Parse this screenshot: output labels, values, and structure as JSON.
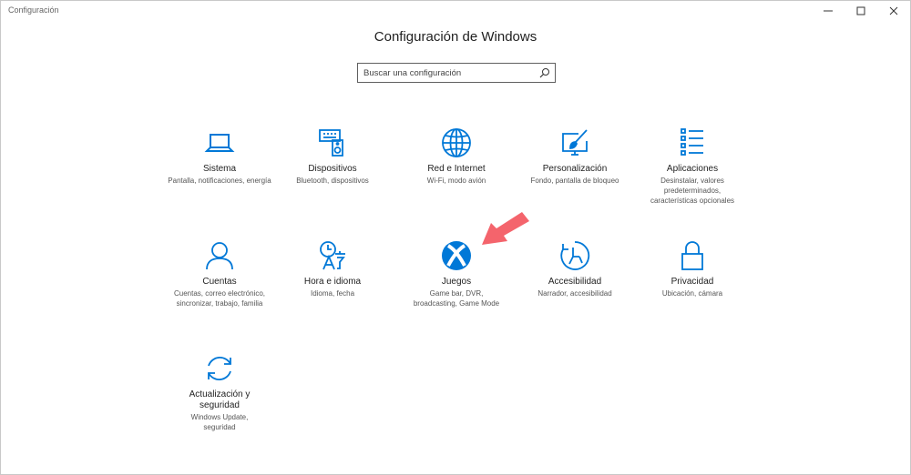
{
  "window": {
    "app_title": "Configuración",
    "controls": [
      "minimize-icon",
      "maximize-icon",
      "close-icon"
    ]
  },
  "header": {
    "title": "Configuración de Windows"
  },
  "search": {
    "placeholder": "Buscar una configuración",
    "icon": "search-icon"
  },
  "colors": {
    "accent": "#0078d7",
    "annotation_arrow": "#f4646c"
  },
  "tiles": [
    {
      "name": "Sistema",
      "desc": "Pantalla, notificaciones, energía",
      "icon": "laptop-icon"
    },
    {
      "name": "Dispositivos",
      "desc": "Bluetooth, dispositivos",
      "icon": "keyboard-speaker-icon"
    },
    {
      "name": "Red e Internet",
      "desc": "Wi-Fi, modo avión",
      "icon": "globe-icon"
    },
    {
      "name": "Personalización",
      "desc": "Fondo, pantalla de bloqueo",
      "icon": "paint-monitor-icon"
    },
    {
      "name": "Aplicaciones",
      "desc": "Desinstalar, valores predeterminados, características opcionales",
      "icon": "apps-list-icon"
    },
    {
      "name": "Cuentas",
      "desc": "Cuentas, correo electrónico, sincronizar, trabajo, familia",
      "icon": "person-icon"
    },
    {
      "name": "Hora e idioma",
      "desc": "Idioma, fecha",
      "icon": "time-language-icon"
    },
    {
      "name": "Juegos",
      "desc": "Game bar, DVR, broadcasting, Game Mode",
      "icon": "xbox-icon"
    },
    {
      "name": "Accesibilidad",
      "desc": "Narrador, accesibilidad",
      "icon": "ease-of-access-icon"
    },
    {
      "name": "Privacidad",
      "desc": "Ubicación, cámara",
      "icon": "lock-icon"
    },
    {
      "name": "Actualización y seguridad",
      "desc": "Windows Update, seguridad",
      "icon": "sync-icon"
    }
  ]
}
